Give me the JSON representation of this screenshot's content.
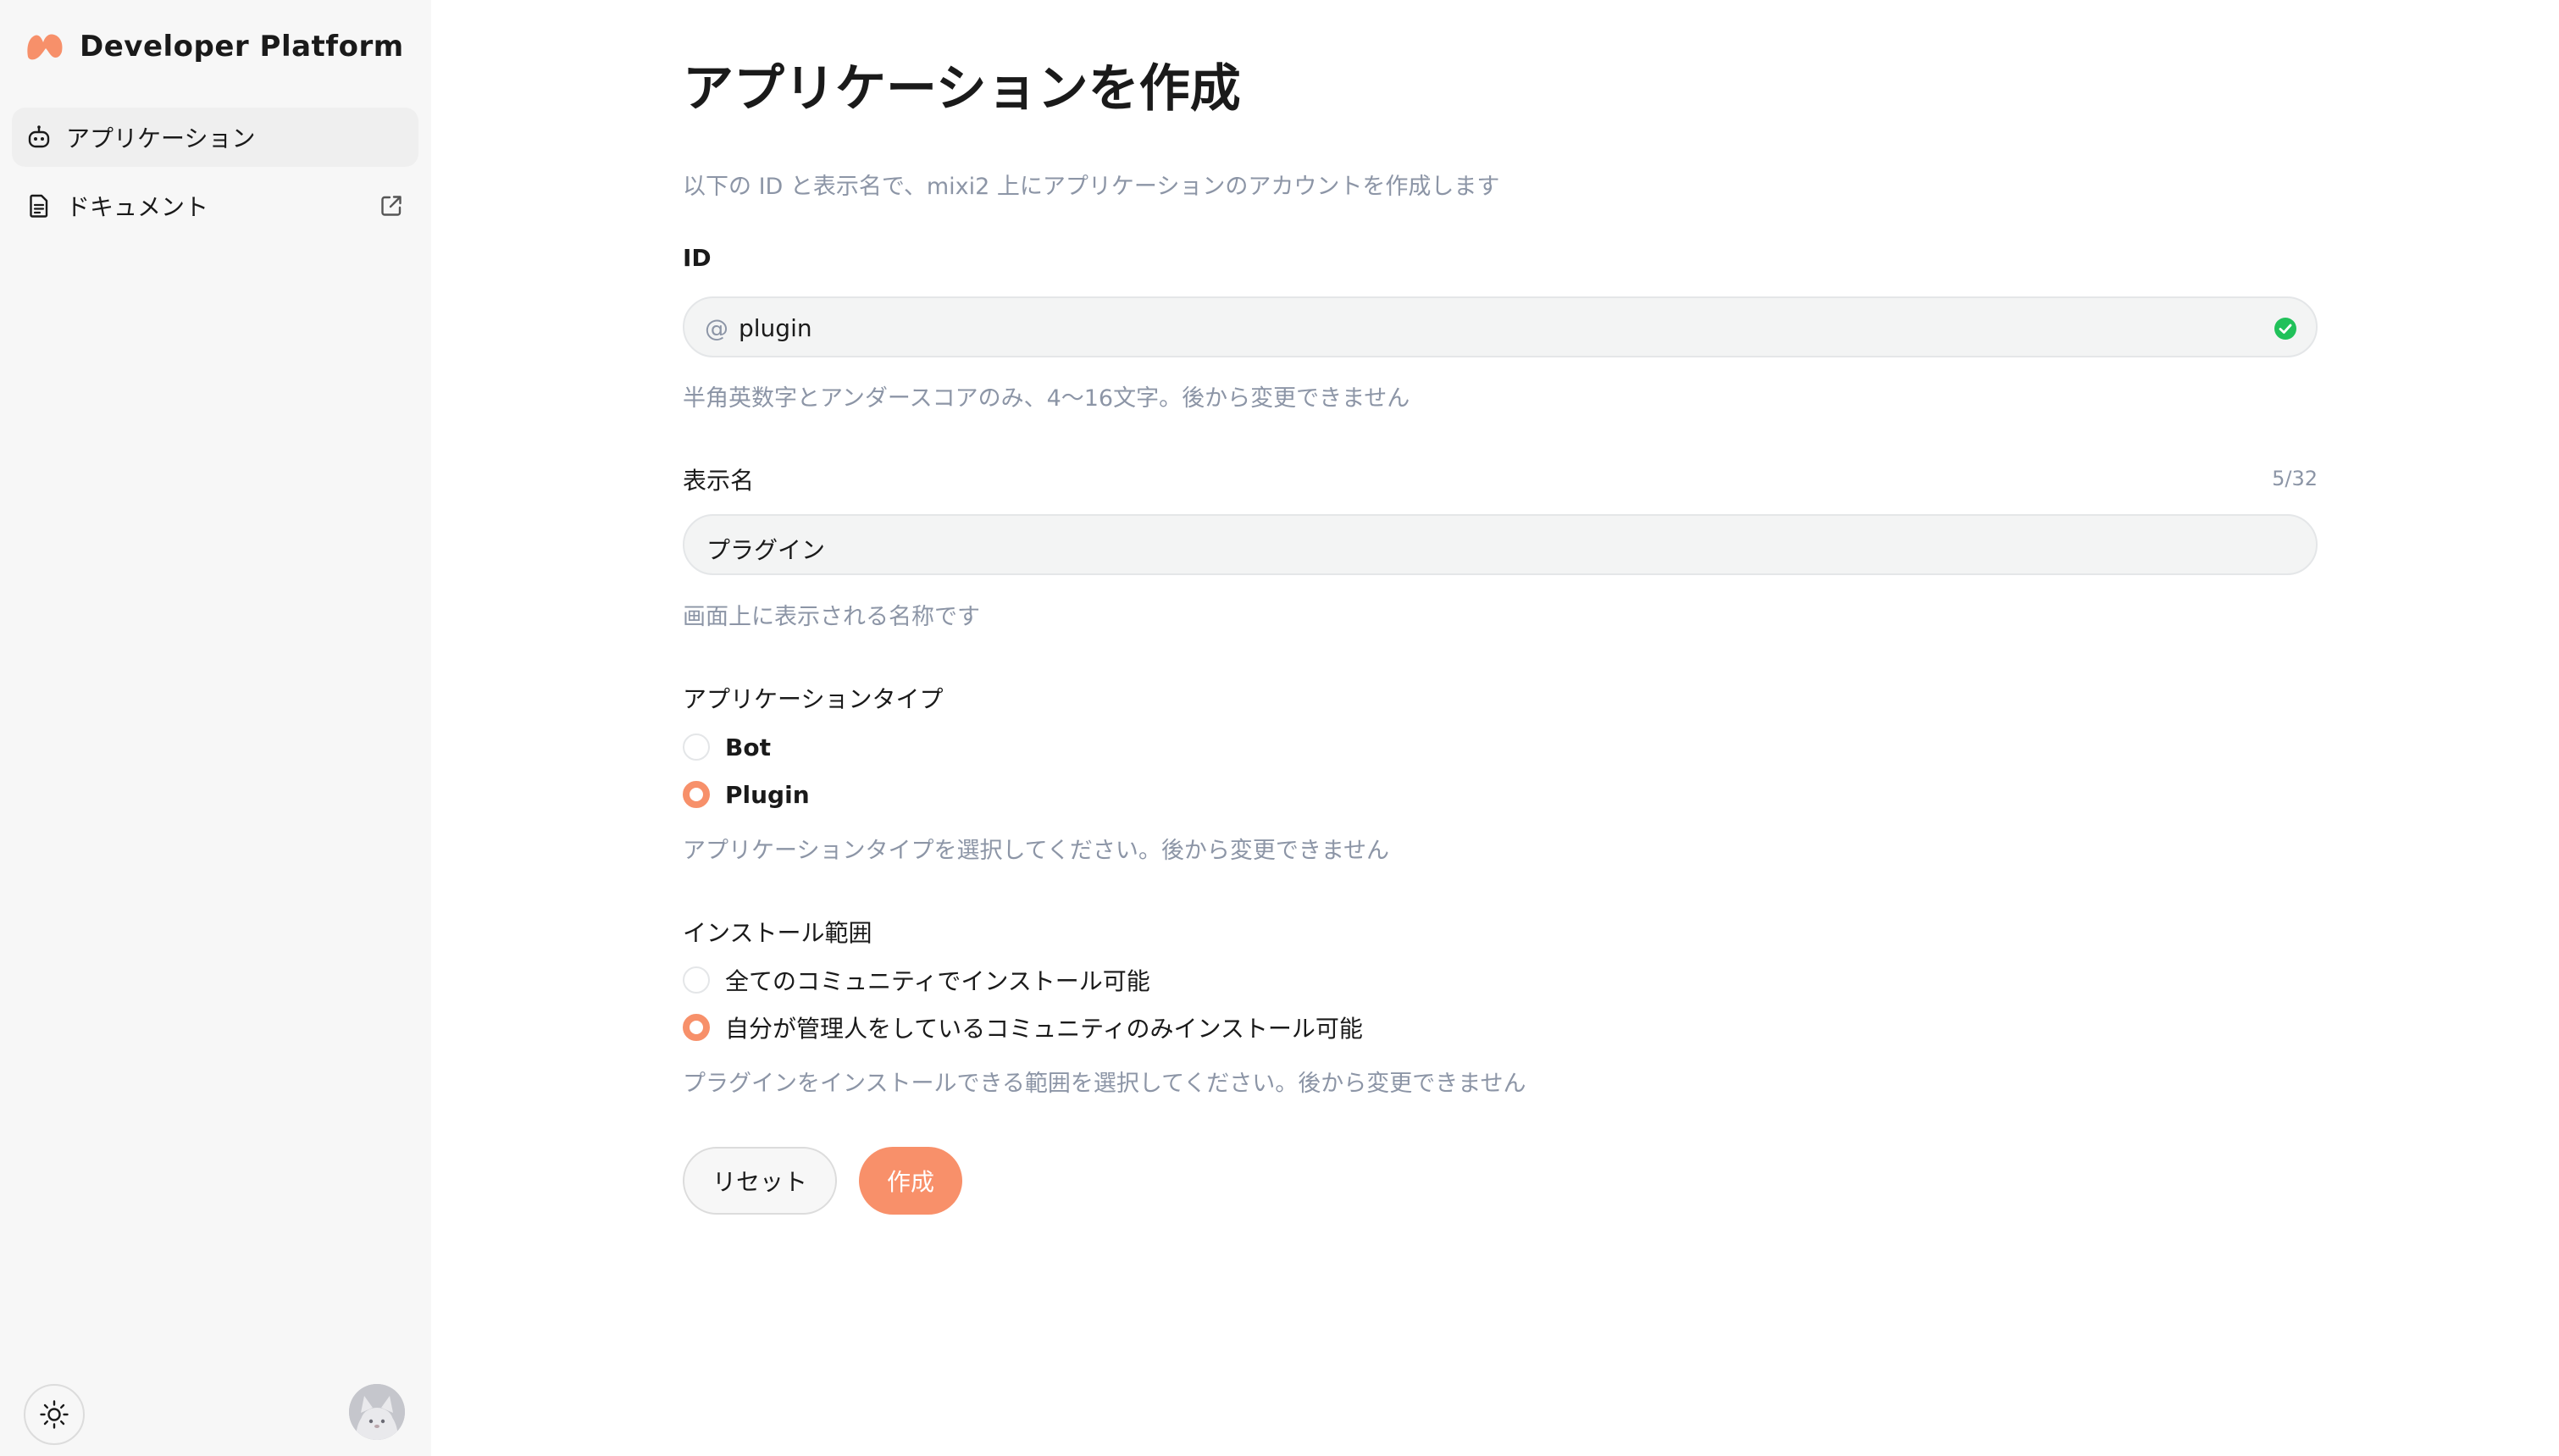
{
  "app": {
    "brand_name": "Developer Platform",
    "accent_color": "#f7906a"
  },
  "sidebar": {
    "items": [
      {
        "label": "アプリケーション",
        "icon": "robot-icon",
        "active": true
      },
      {
        "label": "ドキュメント",
        "icon": "document-icon",
        "external_icon": "external-link-icon"
      }
    ],
    "theme_toggle_icon": "sun-icon",
    "avatar_icon": "avatar"
  },
  "page": {
    "title": "アプリケーションを作成",
    "intro": "以下の ID と表示名で、mixi2 上にアプリケーションのアカウントを作成します"
  },
  "form": {
    "id": {
      "label": "ID",
      "prefix": "@",
      "value": "plugin",
      "valid": true,
      "help": "半角英数字とアンダースコアのみ、4〜16文字。後から変更できません"
    },
    "display_name": {
      "label": "表示名",
      "counter": "5/32",
      "value": "プラグイン",
      "help": "画面上に表示される名称です"
    },
    "app_type": {
      "label": "アプリケーションタイプ",
      "options": [
        {
          "label": "Bot",
          "checked": false
        },
        {
          "label": "Plugin",
          "checked": true
        }
      ],
      "help": "アプリケーションタイプを選択してください。後から変更できません"
    },
    "install_scope": {
      "label": "インストール範囲",
      "options": [
        {
          "label": "全てのコミュニティでインストール可能",
          "checked": false
        },
        {
          "label": "自分が管理人をしているコミュニティのみインストール可能",
          "checked": true
        }
      ],
      "help": "プラグインをインストールできる範囲を選択してください。後から変更できません"
    },
    "reset_label": "リセット",
    "create_label": "作成"
  }
}
